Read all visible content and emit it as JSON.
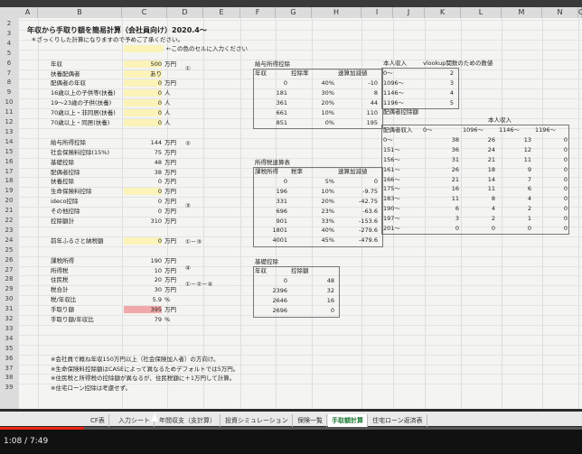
{
  "column_headers": [
    "A",
    "B",
    "C",
    "D",
    "E",
    "F",
    "G",
    "H",
    "I",
    "J",
    "K",
    "L",
    "M",
    "N",
    "O"
  ],
  "rows": [
    "2",
    "3",
    "4",
    "5",
    "6",
    "7",
    "8",
    "9",
    "10",
    "11",
    "12",
    "13",
    "14",
    "15",
    "16",
    "17",
    "18",
    "19",
    "20",
    "21",
    "22",
    "23",
    "24",
    "25",
    "26",
    "27",
    "28",
    "29",
    "30",
    "31",
    "32",
    "33",
    "34",
    "35",
    "36",
    "37",
    "38",
    "39"
  ],
  "title": "年収から手取り額を簡易計算（会社員向け）2020.4～",
  "subtitle": "＊ざっくりした計算になりますので予めご了承ください。",
  "input_note": "←この色のセルに入力ください",
  "left_labels": [
    "年収",
    "扶養配偶者",
    "配偶者の年収",
    "16歳以上の子供等(扶養)",
    "19～23歳の子供(扶養)",
    "70歳以上・非同居(扶養)",
    "70歳以上・同居(扶養)",
    "",
    "給与所得控除",
    "社会保険料控除(15%)",
    "基礎控除",
    "配偶者控除",
    "扶養控除",
    "生命保険料控除",
    "ideco控除",
    "その他控除",
    "控除額計",
    "",
    "前年ふるさと納税額",
    "",
    "課税所得",
    "所得税",
    "住民税",
    "税合計",
    "税/年収比",
    "手取り額",
    "手取り額/年収比"
  ],
  "left_values": [
    "500",
    "あり",
    "0",
    "0",
    "0",
    "0",
    "0",
    "",
    "144",
    "75",
    "48",
    "38",
    "0",
    "0",
    "0",
    "0",
    "310",
    "",
    "0",
    "",
    "190",
    "10",
    "20",
    "30",
    "5.9",
    "395",
    "79"
  ],
  "left_units": [
    "万円",
    "",
    "万円",
    "人",
    "人",
    "人",
    "人",
    "",
    "万円",
    "万円",
    "万円",
    "万円",
    "万円",
    "万円",
    "万円",
    "万円",
    "万円",
    "",
    "万円",
    "",
    "万円",
    "万円",
    "万円",
    "万円",
    "%",
    "万円",
    "%"
  ],
  "marks": {
    "m1": "①",
    "m2": "②",
    "m3": "③",
    "m13": "①－③",
    "m4": "④",
    "m5": "①－②－④"
  },
  "notes": [
    "※会社員で概ね年収150万円以上（社会保険加入者）の方向け。",
    "※生命保険料控除額はCASEによって異なるためデフォルトでは5万円。",
    "※住民税と所得税の控除額が異なるが、住民税額に＋1万円して計算。",
    "※住宅ローン控除は考慮せず。"
  ],
  "tbl_kyuyo": {
    "title": "給与所得控除",
    "headers": [
      "年収",
      "控除率",
      "速算加減値"
    ],
    "rows": [
      [
        "0",
        "40%",
        "-10"
      ],
      [
        "181",
        "30%",
        "8"
      ],
      [
        "361",
        "20%",
        "44"
      ],
      [
        "661",
        "10%",
        "110"
      ],
      [
        "851",
        "0%",
        "195"
      ]
    ]
  },
  "tbl_shotoku": {
    "title": "所得税速算表",
    "headers": [
      "課税所得",
      "税率",
      "速算加減値"
    ],
    "rows": [
      [
        "0",
        "5%",
        "0"
      ],
      [
        "196",
        "10%",
        "-9.75"
      ],
      [
        "331",
        "20%",
        "-42.75"
      ],
      [
        "696",
        "23%",
        "-63.6"
      ],
      [
        "901",
        "33%",
        "-153.6"
      ],
      [
        "1801",
        "40%",
        "-279.6"
      ],
      [
        "4001",
        "45%",
        "-479.6"
      ]
    ]
  },
  "tbl_kiso": {
    "title": "基礎控除",
    "headers": [
      "年収",
      "控除額"
    ],
    "rows": [
      [
        "0",
        "48"
      ],
      [
        "2396",
        "32"
      ],
      [
        "2646",
        "16"
      ],
      [
        "2696",
        "0"
      ]
    ]
  },
  "tbl_vlookup": {
    "title1": "本人収入",
    "title2": "vlookup関数のための数値",
    "rows": [
      [
        "0～",
        "2"
      ],
      [
        "1096～",
        "3"
      ],
      [
        "1146～",
        "4"
      ],
      [
        "1196～",
        "5"
      ]
    ]
  },
  "tbl_haigu": {
    "title": "配偶者控除額",
    "subtitle": "本人収入",
    "headers": [
      "配偶者収入",
      "0～",
      "1096～",
      "1146～",
      "1196～"
    ],
    "rows": [
      [
        "0～",
        "38",
        "26",
        "13",
        "0"
      ],
      [
        "151～",
        "36",
        "24",
        "12",
        "0"
      ],
      [
        "156～",
        "31",
        "21",
        "11",
        "0"
      ],
      [
        "161～",
        "26",
        "18",
        "9",
        "0"
      ],
      [
        "166～",
        "21",
        "14",
        "7",
        "0"
      ],
      [
        "175～",
        "16",
        "11",
        "6",
        "0"
      ],
      [
        "183～",
        "11",
        "8",
        "4",
        "0"
      ],
      [
        "190～",
        "6",
        "4",
        "2",
        "0"
      ],
      [
        "197～",
        "3",
        "2",
        "1",
        "0"
      ],
      [
        "201～",
        "0",
        "0",
        "0",
        "0"
      ]
    ]
  },
  "tabs": [
    "CF表",
    "入力シート",
    "年間収支（支計算）",
    "投資シミュレーション",
    "保険一覧",
    "手取額計算",
    "住宅ローン返済表"
  ],
  "active_tab": 5,
  "player": {
    "time": "1:08 / 7:49",
    "progress": 0.145
  }
}
